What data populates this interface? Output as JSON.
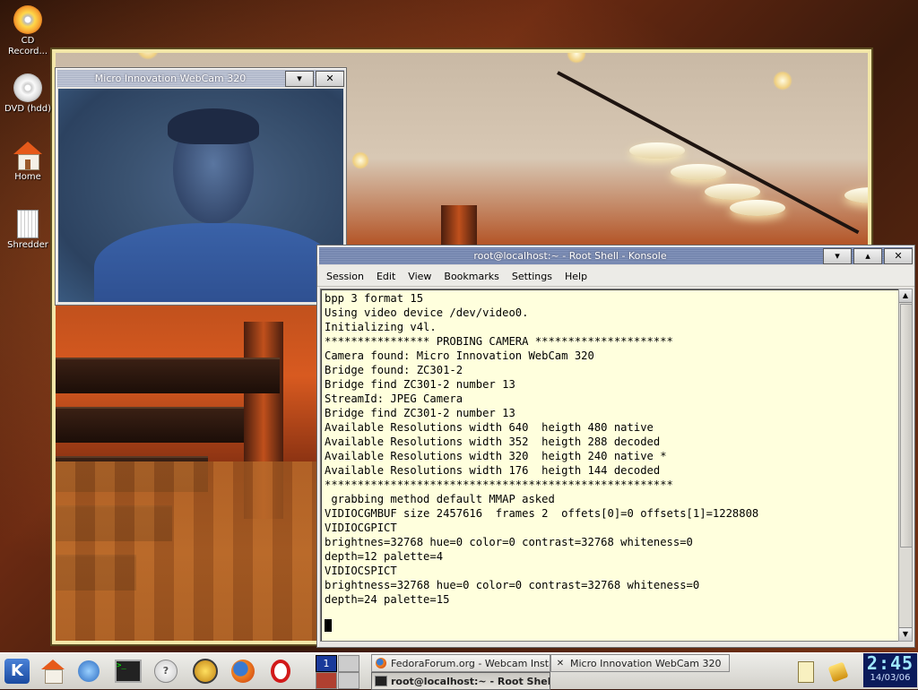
{
  "desktop": {
    "icons": [
      {
        "label": "CD Record...",
        "icon": "cd-icon"
      },
      {
        "label": "DVD (hdd)",
        "icon": "dvd-icon"
      },
      {
        "label": "Home",
        "icon": "home-icon"
      },
      {
        "label": "Shredder",
        "icon": "shredder-icon"
      }
    ]
  },
  "webcam_window": {
    "title": "Micro Innovation WebCam 320",
    "buttons": {
      "shade": "▾",
      "close": "✕"
    }
  },
  "konsole": {
    "title": "root@localhost:~ - Root Shell - Konsole",
    "buttons": {
      "minimize": "▾",
      "maximize": "▴",
      "close": "✕"
    },
    "menu": [
      "Session",
      "Edit",
      "View",
      "Bookmarks",
      "Settings",
      "Help"
    ],
    "lines": [
      "bpp 3 format 15",
      "Using video device /dev/video0.",
      "Initializing v4l.",
      "**************** PROBING CAMERA *********************",
      "Camera found: Micro Innovation WebCam 320",
      "Bridge found: ZC301-2",
      "Bridge find ZC301-2 number 13",
      "StreamId: JPEG Camera",
      "Bridge find ZC301-2 number 13",
      "Available Resolutions width 640  heigth 480 native",
      "Available Resolutions width 352  heigth 288 decoded",
      "Available Resolutions width 320  heigth 240 native *",
      "Available Resolutions width 176  heigth 144 decoded",
      "*****************************************************",
      " grabbing method default MMAP asked",
      "VIDIOCGMBUF size 2457616  frames 2  offets[0]=0 offsets[1]=1228808",
      "VIDIOCGPICT",
      "brightnes=32768 hue=0 color=0 contrast=32768 whiteness=0",
      "depth=12 palette=4",
      "VIDIOCSPICT",
      "brightness=32768 hue=0 color=0 contrast=32768 whiteness=0",
      "depth=24 palette=15"
    ]
  },
  "taskbar": {
    "quicklaunch": [
      "kde-menu-icon",
      "home-icon",
      "network-icon",
      "terminal-icon",
      "help-icon",
      "settings-icon",
      "firefox-icon",
      "opera-icon"
    ],
    "pager_desktop": "1",
    "tasks": [
      {
        "label": "FedoraForum.org - Webcam Installat",
        "icon": "firefox-icon",
        "active": false
      },
      {
        "label": "Micro Innovation WebCam 320",
        "icon": "x-icon",
        "active": false
      },
      {
        "label": "root@localhost:~ - Root Shell -",
        "icon": "terminal-icon",
        "active": true
      }
    ],
    "clock": {
      "time": "2:45",
      "date": "14/03/06"
    }
  }
}
